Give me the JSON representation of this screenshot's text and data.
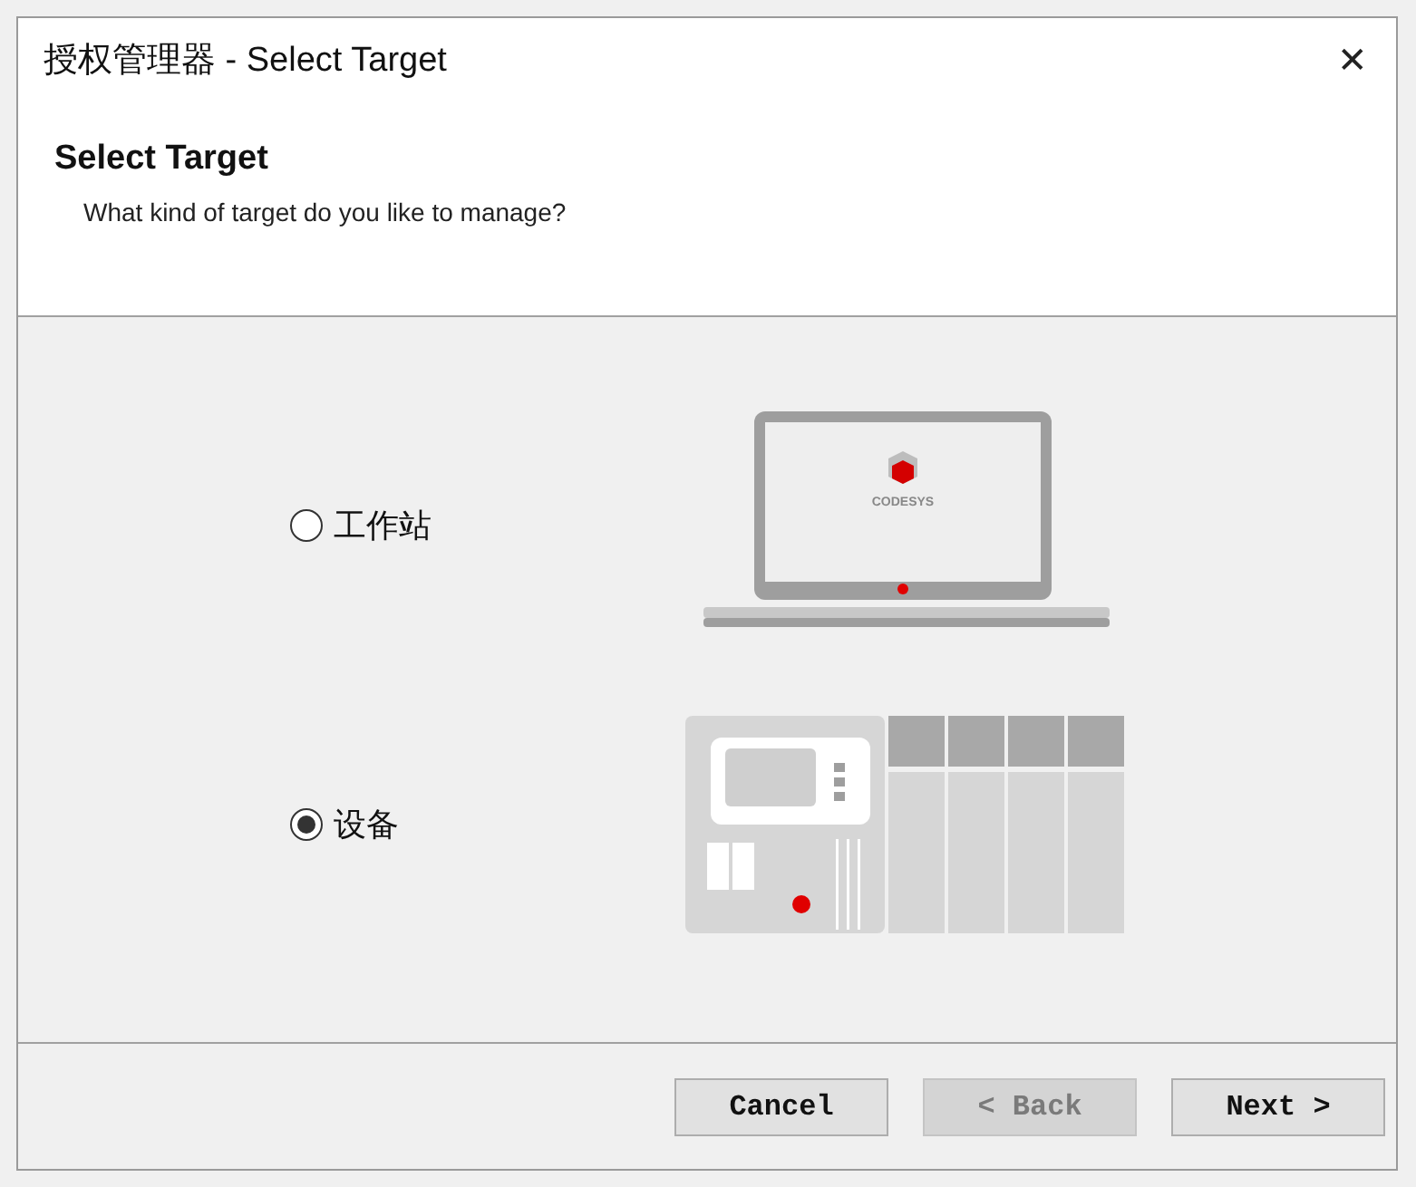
{
  "window": {
    "title": "授权管理器 - Select Target",
    "close_glyph": "✕"
  },
  "header": {
    "title": "Select Target",
    "subtitle": "What kind of target do you like to manage?"
  },
  "options": [
    {
      "kind": "workstation",
      "label": "工作站",
      "selected": false,
      "logo_text": "CODESYS"
    },
    {
      "kind": "device",
      "label": "设备",
      "selected": true
    }
  ],
  "buttons": [
    {
      "label": "Cancel",
      "disabled": false
    },
    {
      "label": "< Back",
      "disabled": true
    },
    {
      "label": "Next >",
      "disabled": false
    }
  ]
}
